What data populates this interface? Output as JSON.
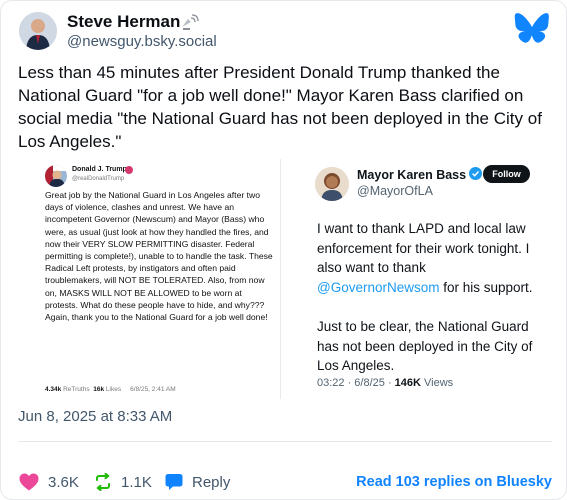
{
  "author": {
    "display_name": "Steve Herman",
    "handle": "@newsguy.bsky.social",
    "name_icon": "satellite-antenna-icon"
  },
  "post": {
    "text": "Less than 45 minutes after President Donald Trump thanked the National Guard \"for a job well done!\" Mayor Karen Bass clarified on social media \"the National Guard has not been deployed in the City of Los Angeles.\"",
    "timestamp": "Jun 8, 2025 at 8:33 AM"
  },
  "embed_left": {
    "name": "Donald J. Trump",
    "handle": "@realDonaldTrump",
    "body": "Great job by the National Guard in Los Angeles after two days of violence, clashes and unrest. We have an incompetent Governor (Newscum) and Mayor (Bass) who were, as usual (just look at how they handled the fires, and now their VERY SLOW PERMITTING disaster. Federal permitting is complete!), unable to to handle the task. These Radical Left protests, by instigators and often paid troublemakers, will NOT BE TOLERATED. Also, from now on, MASKS WILL NOT BE ALLOWED to be worn at protests. What do these people have to hide, and why??? Again, thank you to the National Guard for a job well done!",
    "retruths_count": "4.34k",
    "retruths_label": "ReTruths",
    "likes_count": "16k",
    "likes_label": "Likes",
    "date": "6/8/25, 2:41 AM"
  },
  "embed_right": {
    "name": "Mayor Karen Bass",
    "handle": "@MayorOfLA",
    "follow_label": "Follow",
    "body_p1_a": "I want to thank LAPD and local law enforcement for their work tonight. I also want to thank ",
    "mention": "@GovernorNewsom",
    "body_p1_b": " for his support.",
    "body_p2": "Just to be clear, the National Guard has not been deployed in the City of Los Angeles.",
    "time": "03:22 · 6/8/25 · ",
    "views_count": "146K",
    "views_label": " Views"
  },
  "actions": {
    "likes": "3.6K",
    "reposts": "1.1K",
    "reply_label": "Reply",
    "read_replies": "Read 103 replies on Bluesky"
  },
  "colors": {
    "accent": "#1083fe",
    "like": "#ec4899",
    "repost": "#20bc07",
    "reply": "#1083fe",
    "mention": "#1d9bf0"
  }
}
